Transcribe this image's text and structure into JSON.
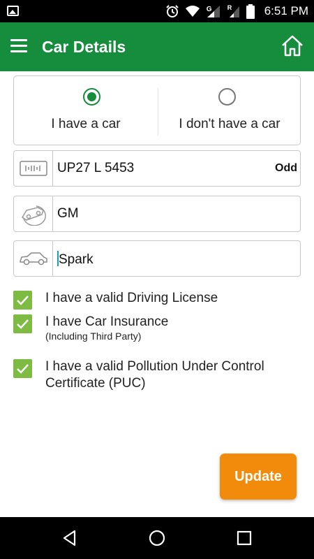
{
  "status_bar": {
    "time": "6:51 PM",
    "icons": [
      "gallery-icon",
      "alarm-icon",
      "wifi-icon",
      "signal-icon",
      "signal-r-icon",
      "battery-icon"
    ],
    "signal_label": "G",
    "roaming_label": "R"
  },
  "app_bar": {
    "title": "Car Details",
    "menu_icon": "menu-icon",
    "home_icon": "home-icon",
    "color": "#168c3d"
  },
  "ownership": {
    "options": [
      {
        "label": "I have a car",
        "selected": true
      },
      {
        "label": "I don't have a car",
        "selected": false
      }
    ]
  },
  "fields": {
    "registration": {
      "value": "UP27 L 5453",
      "tag": "Odd",
      "icon": "number-plate-icon"
    },
    "brand": {
      "value": "GM",
      "icon": "car-brand-icon"
    },
    "model": {
      "value": "Spark",
      "icon": "car-icon"
    }
  },
  "checks": [
    {
      "label": "I have a valid Driving License",
      "sub": "",
      "checked": true
    },
    {
      "label": "I have Car Insurance",
      "sub": "(Including Third Party)",
      "checked": true
    },
    {
      "label": "I have a valid Pollution Under Control Certificate (PUC)",
      "sub": "",
      "checked": true
    }
  ],
  "update_button": {
    "label": "Update",
    "color": "#f28b0c"
  },
  "nav_bar": {
    "buttons": [
      "back-icon",
      "home-circle-icon",
      "recents-icon"
    ]
  }
}
